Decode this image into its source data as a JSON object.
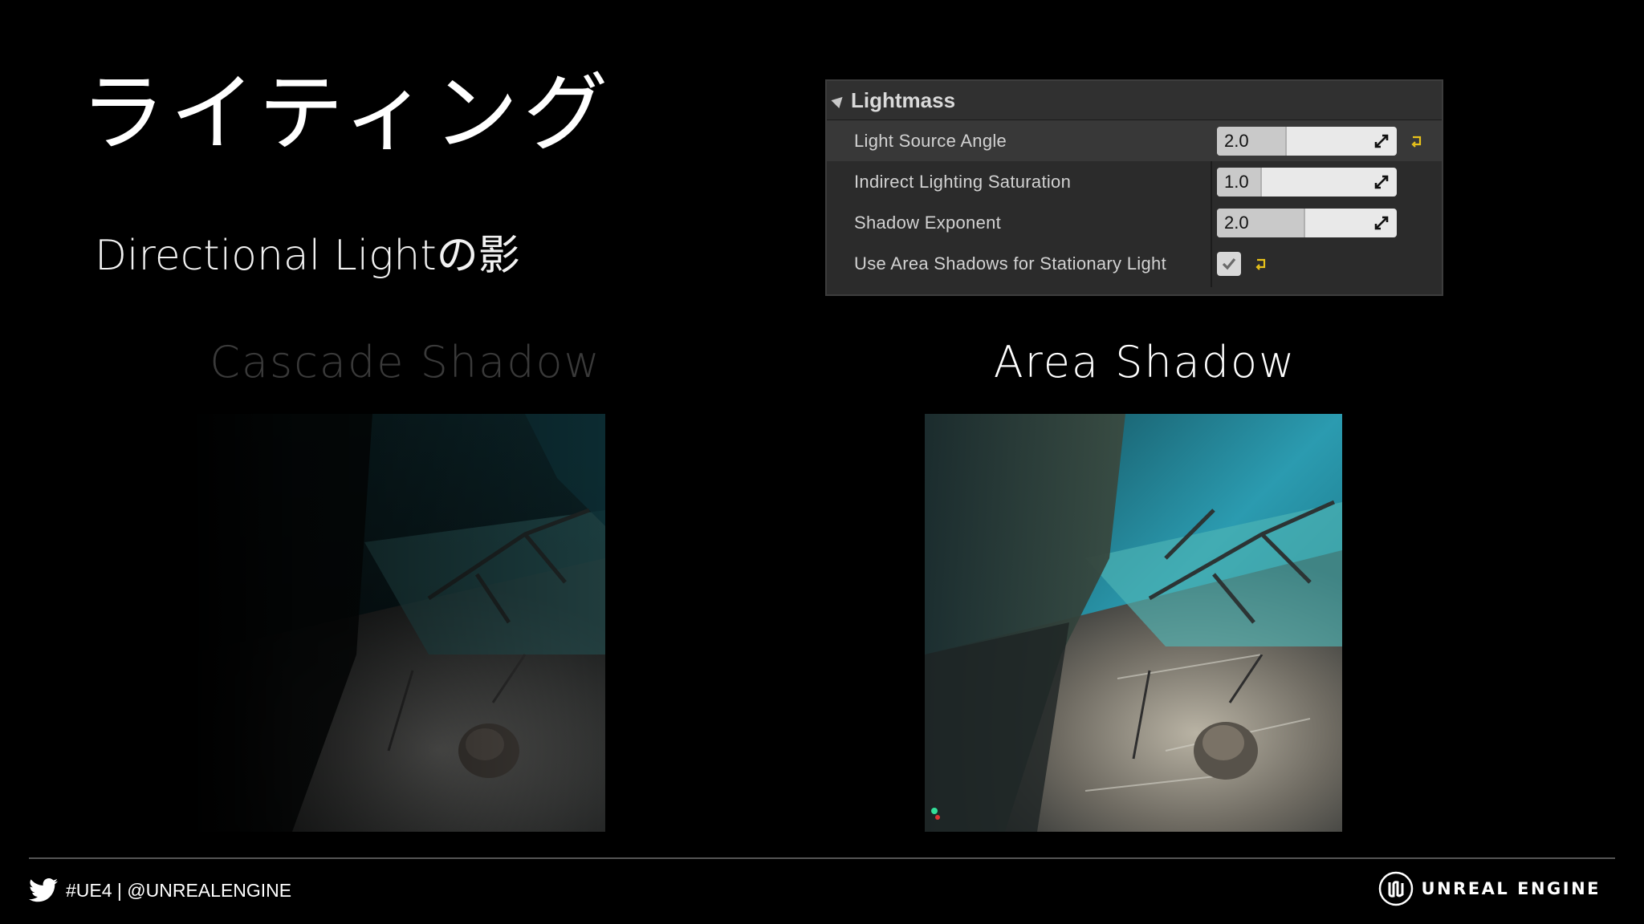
{
  "slide": {
    "title": "ライティング",
    "subtitle": "Directional Lightの影"
  },
  "panel": {
    "section_title": "Lightmass",
    "properties": [
      {
        "label": "Light Source Angle",
        "value": "2.0",
        "fill": 0.38,
        "resettable": true
      },
      {
        "label": "Indirect Lighting Saturation",
        "value": "1.0",
        "fill": 0.24
      },
      {
        "label": "Shadow Exponent",
        "value": "2.0",
        "fill": 0.48
      },
      {
        "label": "Use Area Shadows for Stationary Light",
        "checked": true,
        "resettable": true
      }
    ]
  },
  "captions": {
    "cascade": "Cascade Shadow",
    "area": "Area Shadow"
  },
  "footer": {
    "social": "#UE4 | @UNREALENGINE",
    "brand": "UNREAL ENGINE"
  },
  "colors": {
    "background": "#000000",
    "reset_arrow": "#e8c21a",
    "panel_bg": "#2b2b2b",
    "cascade_caption": "#3a3a3a"
  },
  "icons": [
    "twitter-bird-icon",
    "unreal-engine-logo-icon",
    "expand-arrows-icon",
    "reset-to-default-icon",
    "checkmark-icon",
    "collapse-triangle-icon"
  ]
}
